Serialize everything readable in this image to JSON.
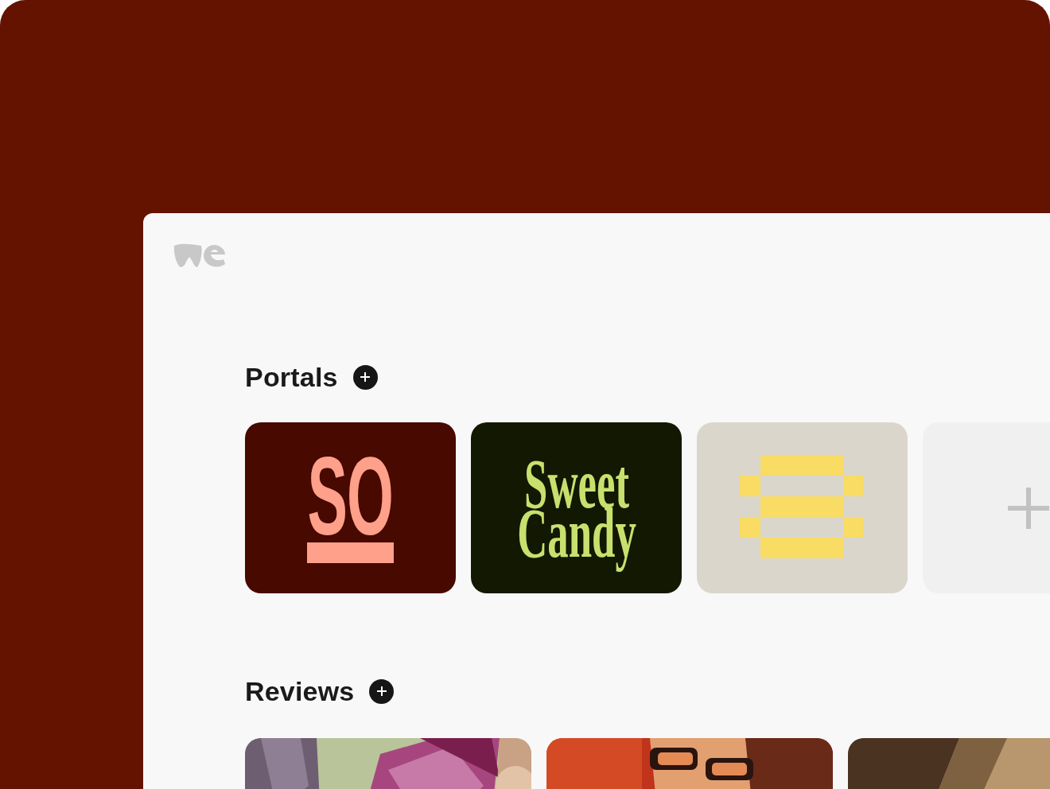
{
  "sections": [
    {
      "title": "Portals",
      "items": [
        {
          "kind": "monogram",
          "text": "SO"
        },
        {
          "kind": "wordmark",
          "text": "Sweet Candy"
        },
        {
          "kind": "pixel"
        },
        {
          "kind": "add"
        }
      ]
    },
    {
      "title": "Reviews"
    }
  ]
}
